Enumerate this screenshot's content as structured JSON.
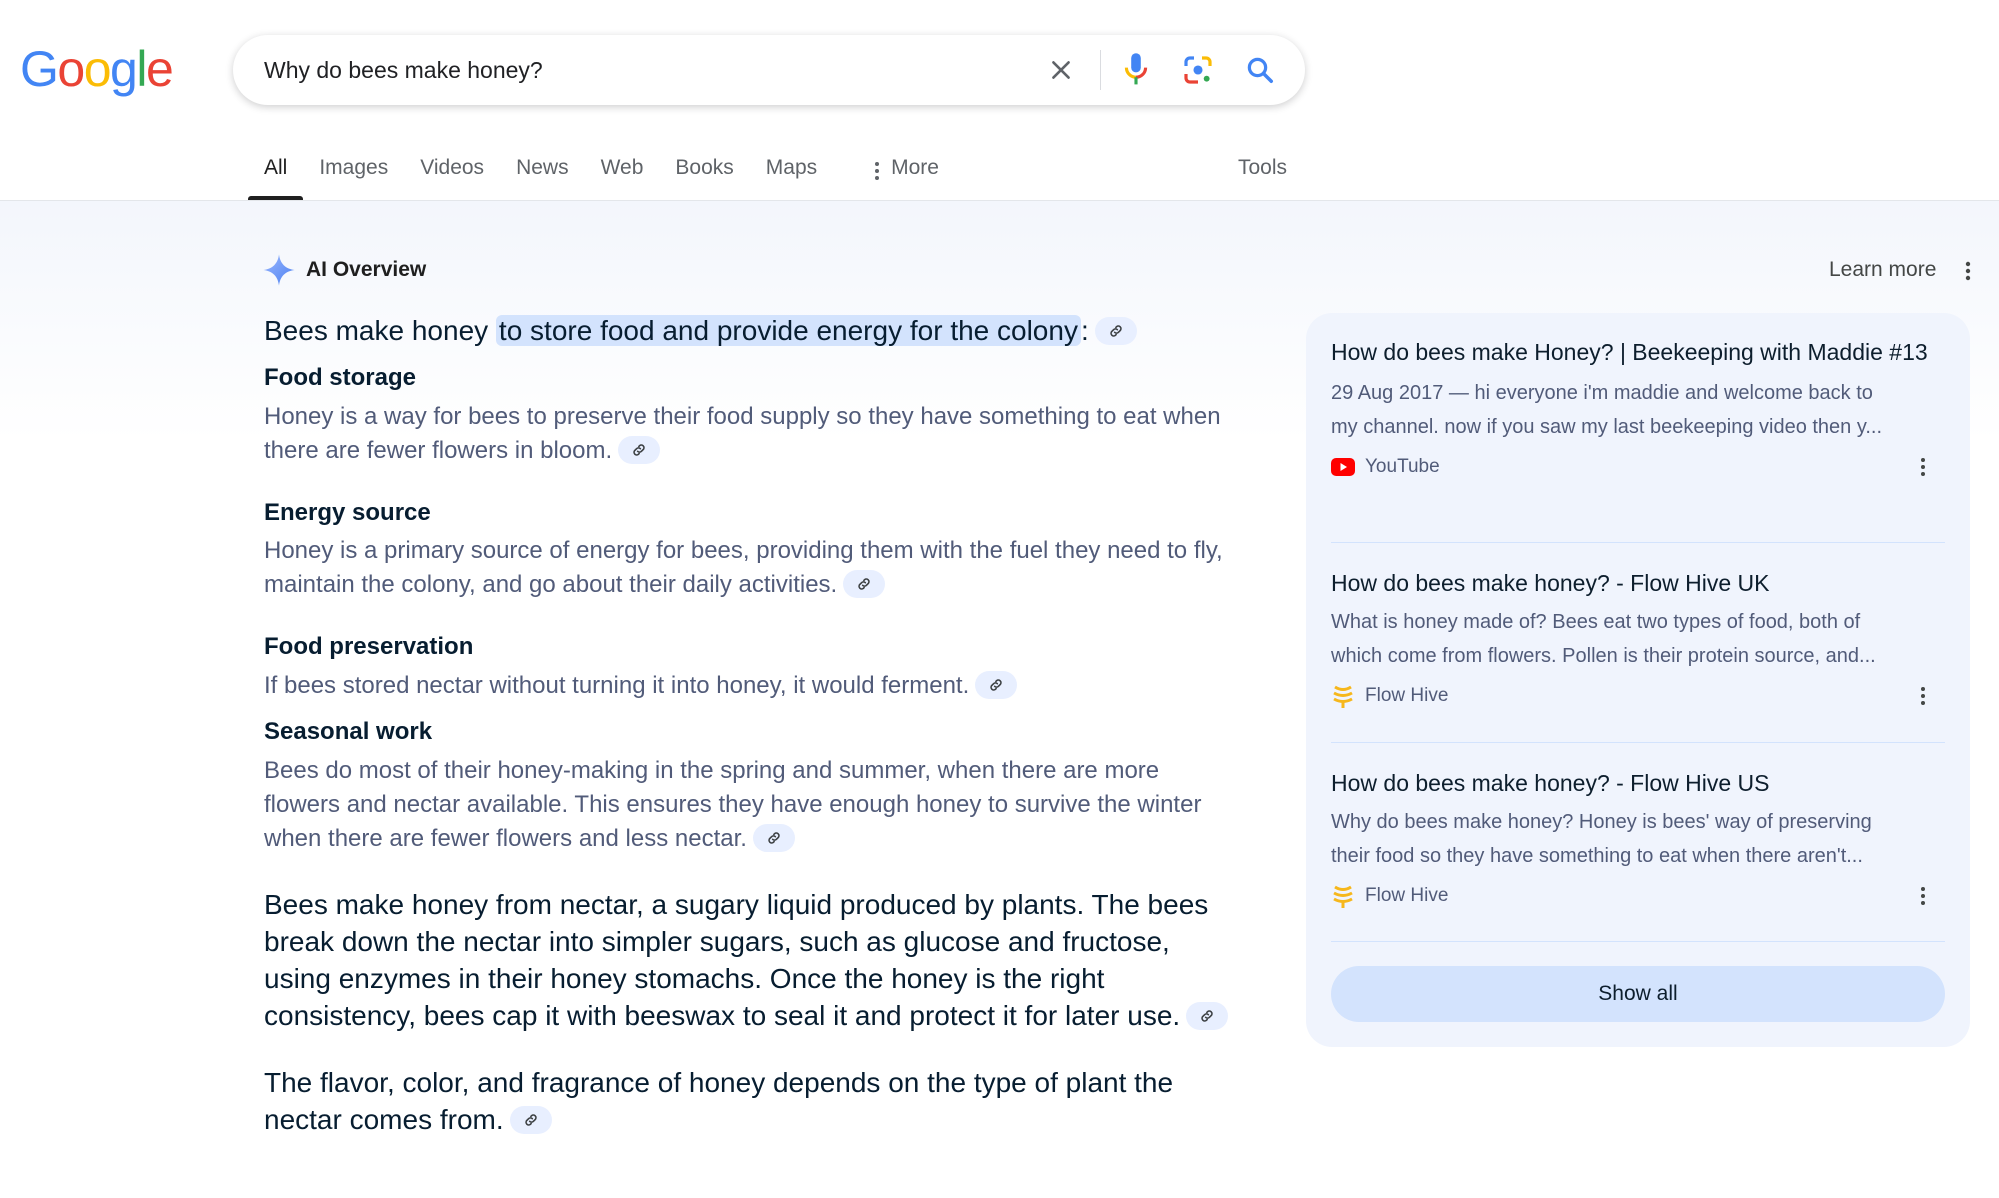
{
  "logo": {
    "letters": [
      {
        "char": "G",
        "color": "#4285f4"
      },
      {
        "char": "o",
        "color": "#ea4335"
      },
      {
        "char": "o",
        "color": "#fbbc05"
      },
      {
        "char": "g",
        "color": "#4285f4"
      },
      {
        "char": "l",
        "color": "#34a853"
      },
      {
        "char": "e",
        "color": "#ea4335"
      }
    ]
  },
  "search": {
    "query": "Why do bees make honey?",
    "clear_icon": "close-icon",
    "mic_icon": "microphone-icon",
    "lens_icon": "google-lens-icon",
    "search_icon": "search-icon"
  },
  "tabs": [
    {
      "label": "All",
      "active": true
    },
    {
      "label": "Images"
    },
    {
      "label": "Videos"
    },
    {
      "label": "News"
    },
    {
      "label": "Web"
    },
    {
      "label": "Books"
    },
    {
      "label": "Maps"
    },
    {
      "label": "More"
    }
  ],
  "tools_label": "Tools",
  "ai_overview": {
    "title": "AI Overview",
    "learn_more": "Learn more",
    "lead_prefix": "Bees make honey ",
    "lead_highlight": "to store food and provide energy for the colony",
    "lead_suffix": ":",
    "sections": [
      {
        "title": "Food storage",
        "body": "Honey is a way for bees to preserve their food supply so they have something to eat when there are fewer flowers in bloom."
      },
      {
        "title": "Energy source",
        "body": "Honey is a primary source of energy for bees, providing them with the fuel they need to fly, maintain the colony, and go about their daily activities."
      },
      {
        "title": "Food preservation",
        "body": "If bees stored nectar without turning it into honey, it would ferment."
      },
      {
        "title": "Seasonal work",
        "body": "Bees do most of their honey-making in the spring and summer, when there are more flowers and nectar available. This ensures they have enough honey to survive the winter when there are fewer flowers and less nectar."
      }
    ],
    "paragraphs": [
      "Bees make honey from nectar, a sugary liquid produced by plants. The bees break down the nectar into simpler sugars, such as glucose and fructose, using enzymes in their honey stomachs. Once the honey is the right consistency, bees cap it with beeswax to seal it and protect it for later use.",
      "The flavor, color, and fragrance of honey depends on the type of plant the nectar comes from."
    ]
  },
  "sources": [
    {
      "title": "How do bees make Honey? | Beekeeping with Maddie #13",
      "snippet_line1": "29 Aug 2017 — hi everyone i'm maddie and welcome back to",
      "snippet_line2": "my channel. now if you saw my last beekeeping video then y...",
      "site": "YouTube",
      "icon": "youtube-icon"
    },
    {
      "title": "How do bees make honey? - Flow Hive UK",
      "snippet_line1": "What is honey made of? Bees eat two types of food, both of",
      "snippet_line2": "which come from flowers. Pollen is their protein source, and...",
      "site": "Flow Hive",
      "icon": "flow-hive-icon"
    },
    {
      "title": "How do bees make honey? - Flow Hive US",
      "snippet_line1": "Why do bees make honey? Honey is bees' way of preserving",
      "snippet_line2": "their food so they have something to eat when there aren't...",
      "site": "Flow Hive",
      "icon": "flow-hive-icon"
    }
  ],
  "show_all_label": "Show all",
  "colors": {
    "highlight": "#d3e3fd",
    "card_bg": "#f0f4fd",
    "link_chip": "#e8efff",
    "accent_blue": "#4285f4"
  }
}
